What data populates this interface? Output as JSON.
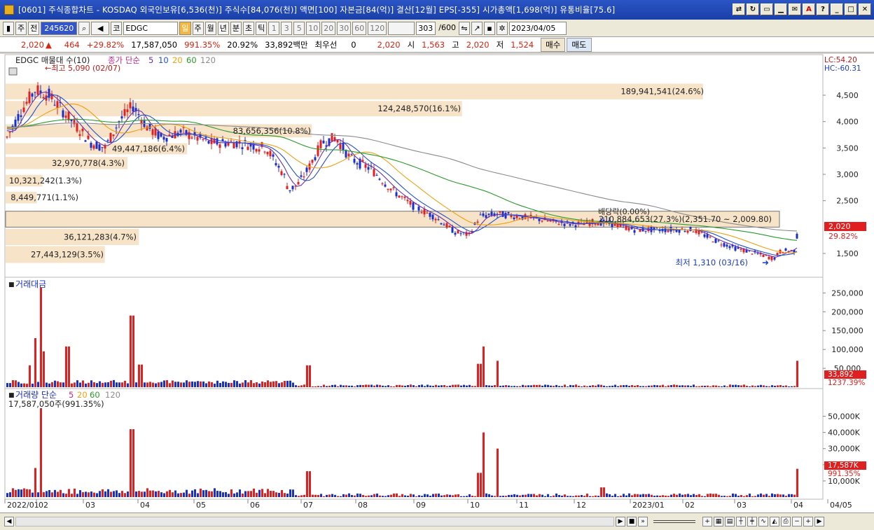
{
  "title": "[0601] 주식종합차트 - KOSDAQ 외국인보유[6,536(천)] 주식수[84,076(천)] 액면[100] 자본금[84(억)] 결산[12월] EPS[-355] 시가총액[1,698(억)] 유통비율[75.6]",
  "toolbar": {
    "type_label": "주",
    "all_label": "전",
    "code": "245620",
    "market_label": "코",
    "symbol": "EDGC",
    "periods": [
      "일",
      "주",
      "월",
      "년",
      "분",
      "초",
      "틱"
    ],
    "minutes": [
      "1",
      "3",
      "5",
      "10",
      "20",
      "30",
      "60",
      "120"
    ],
    "count": "303",
    "count_total": "/600",
    "date": "2023/04/05"
  },
  "info": {
    "price": "2,020",
    "change": "464",
    "pct": "+29.82%",
    "volume": "17,587,050",
    "vol_pct": "991.35%",
    "turnover": "20.92%",
    "amount": "33,892백만",
    "best": "최우선",
    "best_val": "0",
    "bid": "2,020",
    "open_label": "시",
    "open": "1,563",
    "high_label": "고",
    "high": "2,020",
    "low_label": "저",
    "low": "1,524",
    "buy": "매수",
    "sell": "매도"
  },
  "price_panel": {
    "legend_name": "EDGC 매물대 수(10)",
    "legend_ma": "종가 단순",
    "ma_periods": [
      "5",
      "10",
      "20",
      "60",
      "120"
    ],
    "lc": "LC:54.20",
    "hc": "HC:-60.31",
    "high_note": "←최고 5,090 (02/07)",
    "low_note": "최저 1,310 (03/16)",
    "dividend": "배당락(0.00%)",
    "last_price": "2,020",
    "last_pct": "29.82%",
    "y_ticks": [
      "4,500",
      "4,000",
      "3,500",
      "3,000",
      "2,500",
      "1,500"
    ],
    "volume_profile": [
      {
        "label": "189,941,541(24.6%)",
        "pct": 24.6
      },
      {
        "label": "124,248,570(16.1%)",
        "pct": 16.1
      },
      {
        "label": "83,656,356(10.8%)",
        "pct": 10.8
      },
      {
        "label": "49,447,186(6.4%)",
        "pct": 6.4
      },
      {
        "label": "32,970,778(4.3%)",
        "pct": 4.3
      },
      {
        "label": "10,321,242(1.3%)",
        "pct": 1.3
      },
      {
        "label": "8,449,771(1.1%)",
        "pct": 1.1
      },
      {
        "label": "210,884,653(27.3%)(2,351.70 ~ 2,009.80)",
        "pct": 27.3
      },
      {
        "label": "36,121,283(4.7%)",
        "pct": 4.7
      },
      {
        "label": "27,443,129(3.5%)",
        "pct": 3.5
      }
    ]
  },
  "amount_panel": {
    "title": "거래대금",
    "last": "33,892",
    "last_pct": "1237.39%",
    "y_ticks": [
      "250,000",
      "200,000",
      "150,000",
      "100,000",
      "50,000"
    ]
  },
  "volume_panel": {
    "title": "거래량 단순",
    "ma_periods": [
      "5",
      "20",
      "60",
      "120"
    ],
    "value_note": "17,587,050주(991.35%)",
    "last": "17,587K",
    "last_pct": "991.35%",
    "y_ticks": [
      "50,000K",
      "40,000K",
      "30,000K",
      "20,000K",
      "10,000K"
    ]
  },
  "x_axis": [
    "2022/01",
    "02",
    "03",
    "04",
    "05",
    "06",
    "07",
    "08",
    "09",
    "10",
    "11",
    "12",
    "2023/01",
    "02",
    "03",
    "04",
    "04/05"
  ],
  "colors": {
    "up": "#e02020",
    "down": "#1a2ec8",
    "ma5": "#6a2fb0",
    "ma10": "#2050d0",
    "ma20": "#f0a010",
    "ma60": "#2a9a2a",
    "ma120": "#8a8a8a",
    "profile": "#f6e3c8"
  }
}
